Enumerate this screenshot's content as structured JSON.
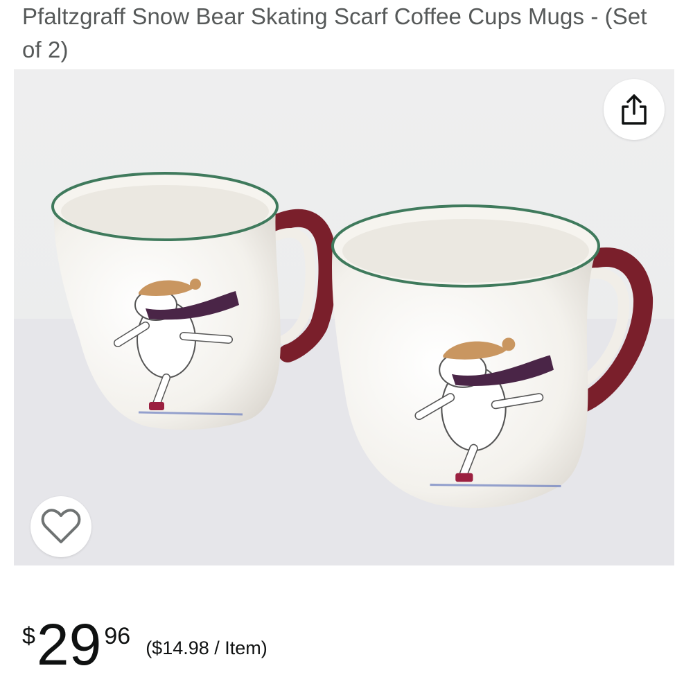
{
  "product": {
    "title": "Pfaltzgraff Snow Bear Skating Scarf Coffee Cups Mugs - (Set of 2)"
  },
  "gallery": {
    "image_description": "product-photo-two-mugs",
    "share_icon": "share-icon",
    "favorite_icon": "heart-icon"
  },
  "price": {
    "symbol": "$",
    "whole": "29",
    "fraction": "96",
    "per_unit": "($14.98 / Item)"
  },
  "colors": {
    "title_text": "#565959",
    "price_text": "#0f1111",
    "mug_rim": "#3f7a5c",
    "mug_handle": "#7a1f2b"
  }
}
